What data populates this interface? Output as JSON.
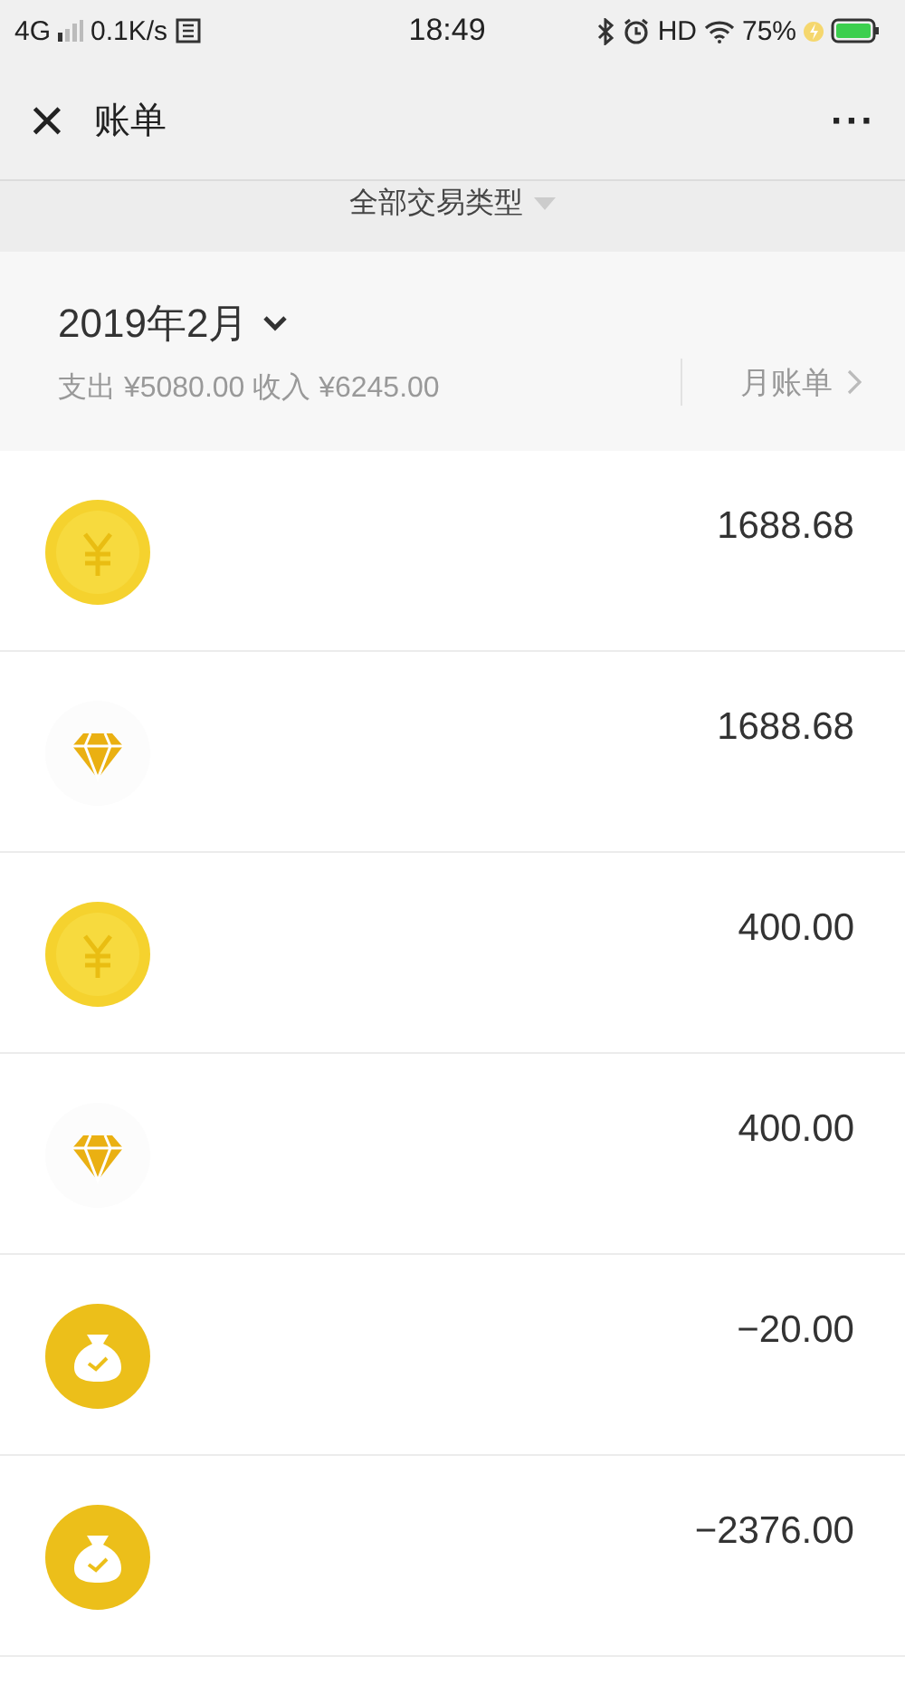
{
  "status_bar": {
    "network": "4G",
    "speed": "0.1K/s",
    "time": "18:49",
    "hd": "HD",
    "battery": "75%"
  },
  "header": {
    "close": "×",
    "title": "账单",
    "more": "···"
  },
  "filter": {
    "label": "全部交易类型"
  },
  "month": {
    "title": "2019年2月",
    "summary": "支出 ¥5080.00 收入 ¥6245.00",
    "monthly_bill": "月账单"
  },
  "transactions": [
    {
      "kind": "coin",
      "amount": "1688.68"
    },
    {
      "kind": "diamond",
      "amount": "1688.68"
    },
    {
      "kind": "coin",
      "amount": "400.00"
    },
    {
      "kind": "diamond",
      "amount": "400.00"
    },
    {
      "kind": "bag",
      "amount": "−20.00"
    },
    {
      "kind": "bag",
      "amount": "−2376.00"
    }
  ]
}
